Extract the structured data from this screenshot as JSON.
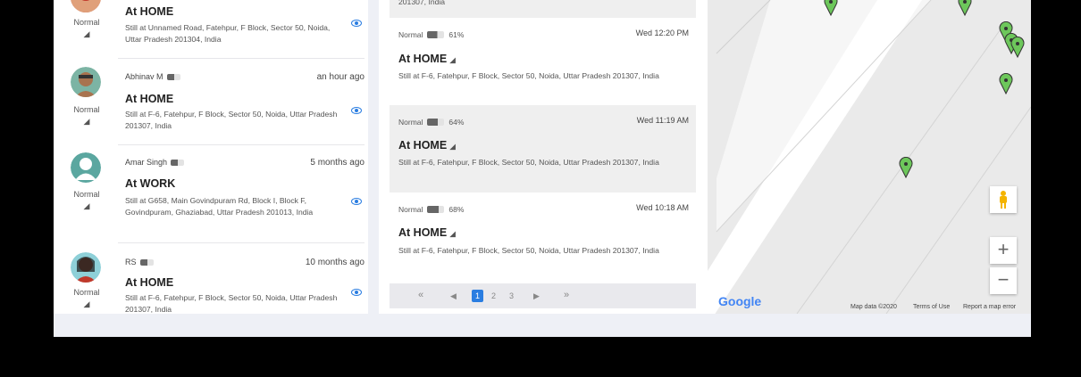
{
  "members": [
    {
      "status": "Normal",
      "name": "",
      "time": "",
      "place": "At HOME",
      "address": "Still at Unnamed Road, Fatehpur, F Block, Sector 50, Noida, Uttar Pradesh 201304, India"
    },
    {
      "status": "Normal",
      "name": "Abhinav M",
      "time": "an hour ago",
      "place": "At HOME",
      "address": "Still at F-6, Fatehpur, F Block, Sector 50, Noida, Uttar Pradesh 201307, India"
    },
    {
      "status": "Normal",
      "name": "Amar Singh",
      "time": "5 months ago",
      "place": "At WORK",
      "address": "Still at G658, Main Govindpuram Rd, Block I, Block F, Govindpuram, Ghaziabad, Uttar Pradesh 201013, India"
    },
    {
      "status": "Normal",
      "name": "RS",
      "time": "10 months ago",
      "place": "At HOME",
      "address": "Still at F-6, Fatehpur, F Block, Sector 50, Noida, Uttar Pradesh 201307, India"
    }
  ],
  "history": {
    "top_partial": "201307, India",
    "entries": [
      {
        "status": "Normal",
        "battery": "61%",
        "battery_level": 0.61,
        "time": "Wed 12:20 PM",
        "place": "At HOME",
        "address": "Still at F-6, Fatehpur, F Block, Sector 50, Noida, Uttar Pradesh 201307, India"
      },
      {
        "status": "Normal",
        "battery": "64%",
        "battery_level": 0.64,
        "time": "Wed 11:19 AM",
        "place": "At HOME",
        "address": "Still at F-6, Fatehpur, F Block, Sector 50, Noida, Uttar Pradesh 201307, India"
      },
      {
        "status": "Normal",
        "battery": "68%",
        "battery_level": 0.68,
        "time": "Wed 10:18 AM",
        "place": "At HOME",
        "address": "Still at F-6, Fatehpur, F Block, Sector 50, Noida, Uttar Pradesh 201307, India"
      }
    ],
    "pagination": {
      "first": "«",
      "prev": "◀",
      "pages": [
        "1",
        "2",
        "3"
      ],
      "current": "1",
      "next": "▶",
      "last": "»"
    }
  },
  "map": {
    "logo": "Google",
    "credits": [
      "Map data ©2020",
      "Terms of Use",
      "Report a map error"
    ],
    "zoom_in": "+",
    "zoom_out": "−"
  },
  "colors": {
    "accent": "#2a7de1",
    "pin": "#6dc75b",
    "map_bg": "#eaeaea"
  }
}
